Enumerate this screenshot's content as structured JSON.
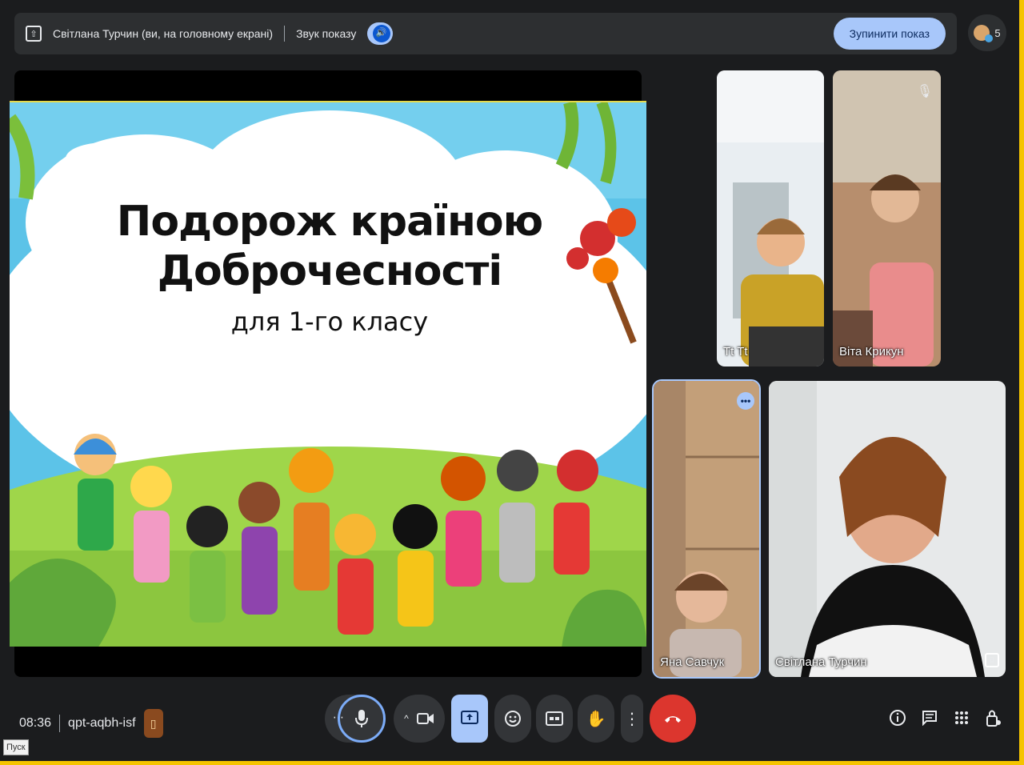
{
  "present_bar": {
    "presenter_label": "Світлана Турчин (ви, на головному екрані)",
    "sound_label": "Звук показу",
    "stop_label": "Зупинити показ"
  },
  "people": {
    "count": "5"
  },
  "slide": {
    "title_line1": "Подорож країною",
    "title_line2": "Доброчесності",
    "subtitle": "для 1-го класу"
  },
  "participants": [
    {
      "name": "Tt Tt"
    },
    {
      "name": "Віта Крикун"
    },
    {
      "name": "Яна Савчук"
    },
    {
      "name": "Світлана Турчин"
    }
  ],
  "meeting": {
    "time": "08:36",
    "code": "qpt-aqbh-isf"
  },
  "taskbar": {
    "start_label": "Пуск"
  },
  "colors": {
    "accent": "#a8c7fa",
    "end_call": "#dc362e",
    "frame": "#f5c400"
  }
}
